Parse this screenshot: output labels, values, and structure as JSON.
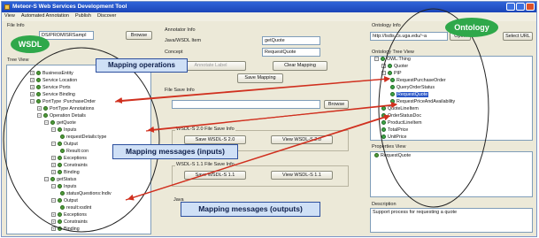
{
  "window": {
    "title": "Meteor-S Web Services Development Tool"
  },
  "menu": [
    "View",
    "Automated Annotation",
    "Publish",
    "Discover"
  ],
  "file_info": {
    "section_label": "File Info",
    "path_value": "DS/PROMISRSampl",
    "browse_label": "Browse",
    "tree_view_label": "Tree View",
    "tree": [
      "BusinessEntity",
      "Service Location",
      "Service Ports",
      "Service Binding",
      "PortType :PurchaseOrder",
      "PortType Annotations",
      "Operation Details",
      "getQuote",
      "Inputs",
      "requestDetails:type",
      "Output",
      "Result:con",
      "Exceptions",
      "Constraints",
      "Binding",
      "getStatus",
      "Inputs",
      "statusQuestions:Indiv",
      "Output",
      "result:xsdint",
      "Exceptions",
      "Constraints",
      "Binding"
    ]
  },
  "annotator": {
    "section_label": "Annotator Info",
    "wsdl_item_label": "Java/WSDL Item",
    "wsdl_item_value": "getQuote",
    "concept_label": "Concept",
    "concept_value": "RequestQuote",
    "annotate_label": "Annotate Label",
    "clear_mapping_label": "Clear Mapping",
    "save_mapping_label": "Save Mapping"
  },
  "file_save": {
    "section_label": "File Save Info",
    "browse_label": "Browse",
    "wsdl_s_label": "WSDL-S 2.0 File Save Info",
    "save_wsdl_s_label": "Save WSDL-S 2.0",
    "view_wsdl_s_label": "View WSDL-S 2.0",
    "wsdl_11_label": "WSDL-S 1.1 File Save Info",
    "save_wsdl_11_label": "Save WSDL-S 1.1",
    "view_wsdl_11_label": "View WSDL-S 1.1",
    "java_label": "Java"
  },
  "ontology": {
    "section_label": "Ontology Info",
    "url_value": "http://lsdis.cs.uga.edu/~a",
    "open_label": "Open",
    "select_url_label": "Select URL",
    "tree_view_label": "Ontology Tree View",
    "tree": [
      "OWL:Thing",
      "Quoter",
      "PIP",
      "RequestPurchaseOrder",
      "QueryOrderStatus",
      "RequestQuote",
      "RequestPriceAndAvailability",
      "QuoteLineItem",
      "OrderStatusDoc",
      "ProductLineItem",
      "TotalPrice",
      "UnitPrice"
    ],
    "properties_label": "Properties View",
    "properties_item": "RequestQuote",
    "description_label": "Description",
    "description_text": "Support process for requesting a quote"
  },
  "callouts": {
    "wsdl": "WSDL",
    "ontology": "Ontology",
    "mapping_ops": "Mapping operations",
    "mapping_inputs": "Mapping messages (inputs)",
    "mapping_outputs": "Mapping messages (outputs)"
  },
  "colors": {
    "titlebar": "#1b45b8",
    "callout_fill": "#cfe0f6",
    "callout_border": "#2c4f9e",
    "green": "#2fa84a",
    "arrow_red": "#d0301f"
  }
}
